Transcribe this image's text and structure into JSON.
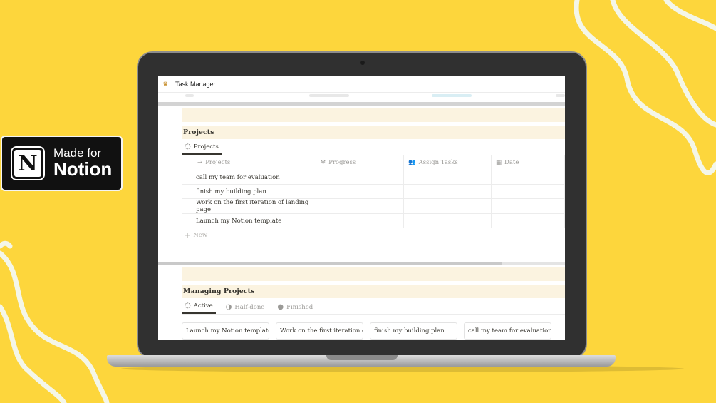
{
  "badge": {
    "line1": "Made for",
    "line2": "Notion",
    "logo_letter": "N"
  },
  "window": {
    "title": "Task Manager",
    "title_icon": "trophy-icon"
  },
  "projects_section": {
    "heading": "Projects",
    "tab": "Projects",
    "columns": [
      "Projects",
      "Progress",
      "Assign Tasks",
      "Date"
    ],
    "rows": [
      {
        "name": "call my team for evaluation",
        "progress": "",
        "assign": "",
        "date": ""
      },
      {
        "name": "finish my building plan",
        "progress": "",
        "assign": "",
        "date": ""
      },
      {
        "name": "Work on the first iteration of landing page",
        "progress": "",
        "assign": "",
        "date": ""
      },
      {
        "name": "Launch my Notion template",
        "progress": "",
        "assign": "",
        "date": ""
      }
    ],
    "new_label": "New"
  },
  "managing_section": {
    "heading": "Managing Projects",
    "tabs": [
      "Active",
      "Half-done",
      "Finished"
    ],
    "cards": [
      "Launch my Notion template",
      "Work on the first iteration of",
      "finish my building plan",
      "call my team for evaluation"
    ]
  },
  "colors": {
    "background": "#fdd63c",
    "section_band": "#fbf3e0",
    "text": "#37352f",
    "muted": "#9b9a97"
  }
}
